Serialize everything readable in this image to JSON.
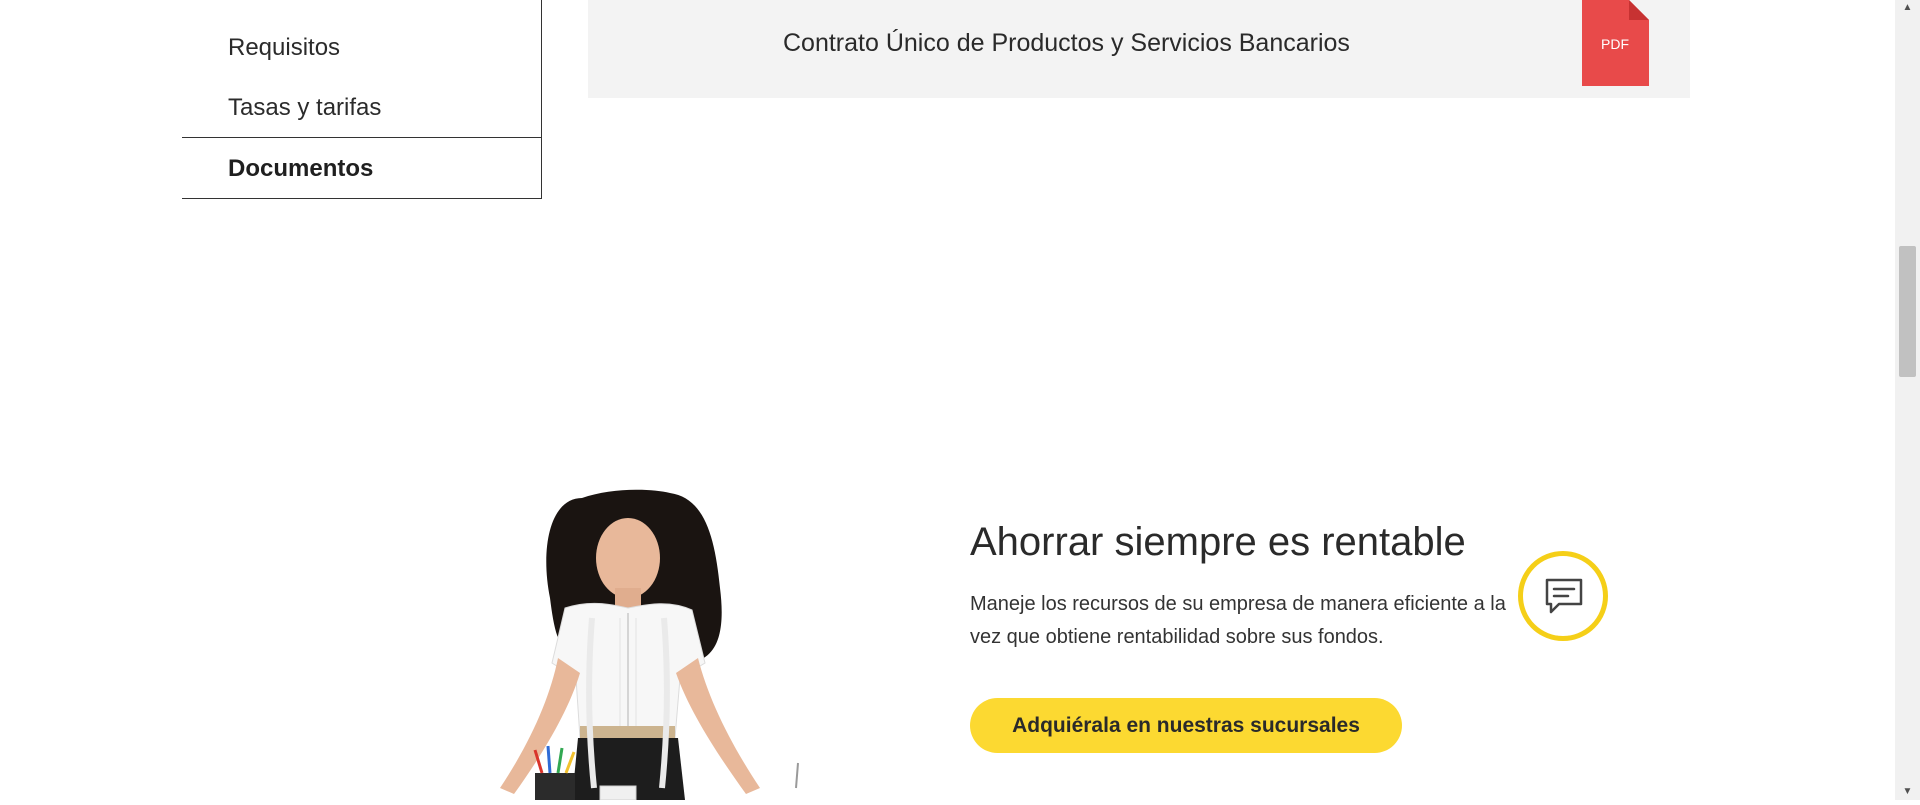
{
  "sidebar": {
    "items": [
      {
        "label": "Requisitos"
      },
      {
        "label": "Tasas y tarifas"
      },
      {
        "label": "Documentos"
      }
    ]
  },
  "documents": {
    "items": [
      {
        "title": "Contrato Único de Productos y Servicios Bancarios",
        "file_type": "PDF"
      }
    ]
  },
  "promo": {
    "title": "Ahorrar siempre es rentable",
    "description": "Maneje los recursos de su empresa de manera eficiente a la vez que obtiene rentabilidad sobre sus fondos.",
    "cta_label": "Adquiérala en nuestras sucursales"
  },
  "icons": {
    "chat": "chat-bubble-icon",
    "pdf": "pdf-file-icon"
  },
  "colors": {
    "accent_yellow": "#fcd931",
    "pdf_red": "#e84a4a",
    "doc_row_bg": "#f3f3f3"
  }
}
